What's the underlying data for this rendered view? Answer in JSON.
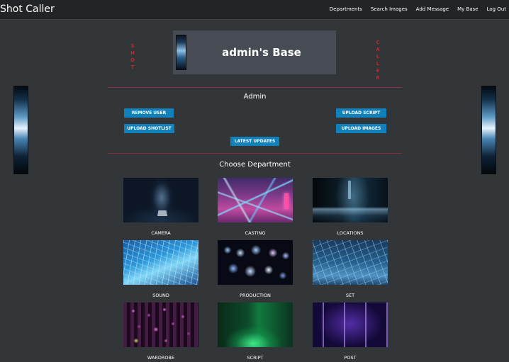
{
  "navbar": {
    "brand": "Shot Caller",
    "links": [
      "Departments",
      "Search Images",
      "Add Message",
      "My Base",
      "Log Out"
    ]
  },
  "header": {
    "left_vertical": [
      "S",
      "H",
      "O",
      "T"
    ],
    "right_vertical": [
      "C",
      "A",
      "L",
      "L",
      "E",
      "R"
    ],
    "title": "admin's Base"
  },
  "admin": {
    "title": "Admin",
    "buttons": {
      "remove_user": "REMOVE USER",
      "upload_script": "UPLOAD SCRIPT",
      "upload_shotlist": "UPLOAD SHOTLIST",
      "upload_images": "UPLOAD IMAGES",
      "latest_updates": "LATEST UPDATES"
    }
  },
  "departments": {
    "title": "Choose Department",
    "items": [
      {
        "label": "CAMERA"
      },
      {
        "label": "CASTING"
      },
      {
        "label": "LOCATIONS"
      },
      {
        "label": "SOUND"
      },
      {
        "label": "PRODUCTION"
      },
      {
        "label": "SET"
      },
      {
        "label": "WARDROBE"
      },
      {
        "label": "SCRIPT"
      },
      {
        "label": "POST"
      }
    ]
  },
  "colors": {
    "accent_blue": "#1181bc",
    "accent_red": "#c0272d",
    "rule": "#8b2a3b",
    "background": "#333638",
    "navbar": "#222426"
  }
}
